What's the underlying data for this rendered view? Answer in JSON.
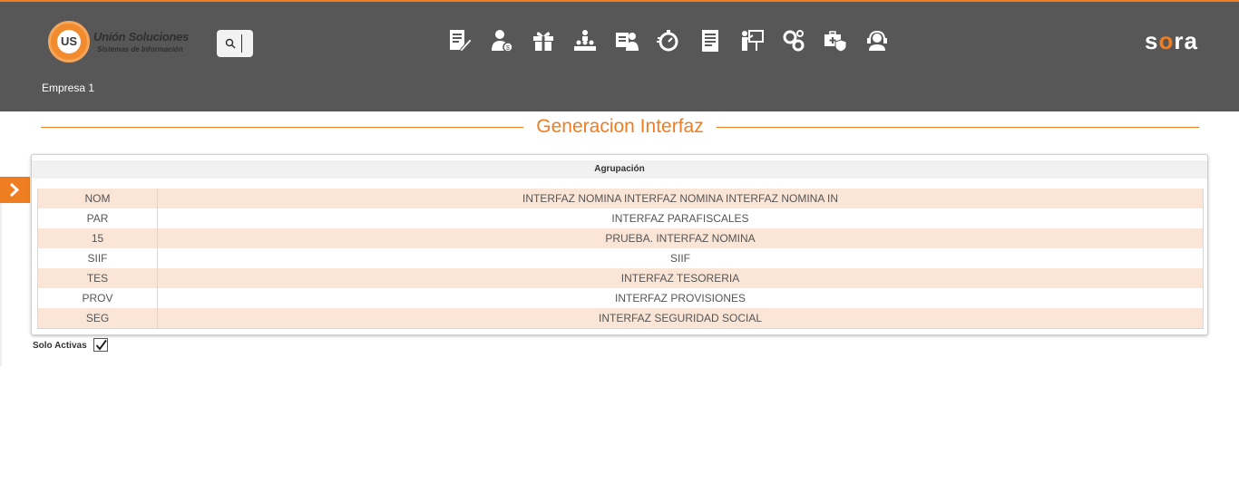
{
  "header": {
    "logo": {
      "mark": "US",
      "title": "Unión Soluciones",
      "subtitle": "Sistemas de Información"
    },
    "search_icon": "search-icon",
    "nav_icons": [
      "document-edit-icon",
      "user-money-icon",
      "gift-icon",
      "hierarchy-icon",
      "user-card-icon",
      "stopwatch-icon",
      "report-icon",
      "presentation-icon",
      "gears-icon",
      "medical-shield-icon",
      "support-agent-icon"
    ],
    "brand": {
      "pre": "s",
      "accent": "o",
      "post": "ra"
    },
    "company": "Empresa 1"
  },
  "page": {
    "title": "Generacion Interfaz"
  },
  "table": {
    "header": "Agrupación",
    "rows": [
      {
        "code": "NOM",
        "name": "INTERFAZ NOMINA INTERFAZ NOMINA INTERFAZ NOMINA IN"
      },
      {
        "code": "PAR",
        "name": "INTERFAZ PARAFISCALES"
      },
      {
        "code": "15",
        "name": "PRUEBA. INTERFAZ NOMINA"
      },
      {
        "code": "SIIF",
        "name": "SIIF"
      },
      {
        "code": "TES",
        "name": "INTERFAZ TESORERIA"
      },
      {
        "code": "PROV",
        "name": "INTERFAZ PROVISIONES"
      },
      {
        "code": "SEG",
        "name": "INTERFAZ SEGURIDAD SOCIAL"
      }
    ]
  },
  "filter": {
    "label": "Solo Activas",
    "checked": true
  },
  "colors": {
    "accent": "#ef7d22",
    "header_bg": "#575757",
    "row_alt": "#fbe5d6"
  }
}
